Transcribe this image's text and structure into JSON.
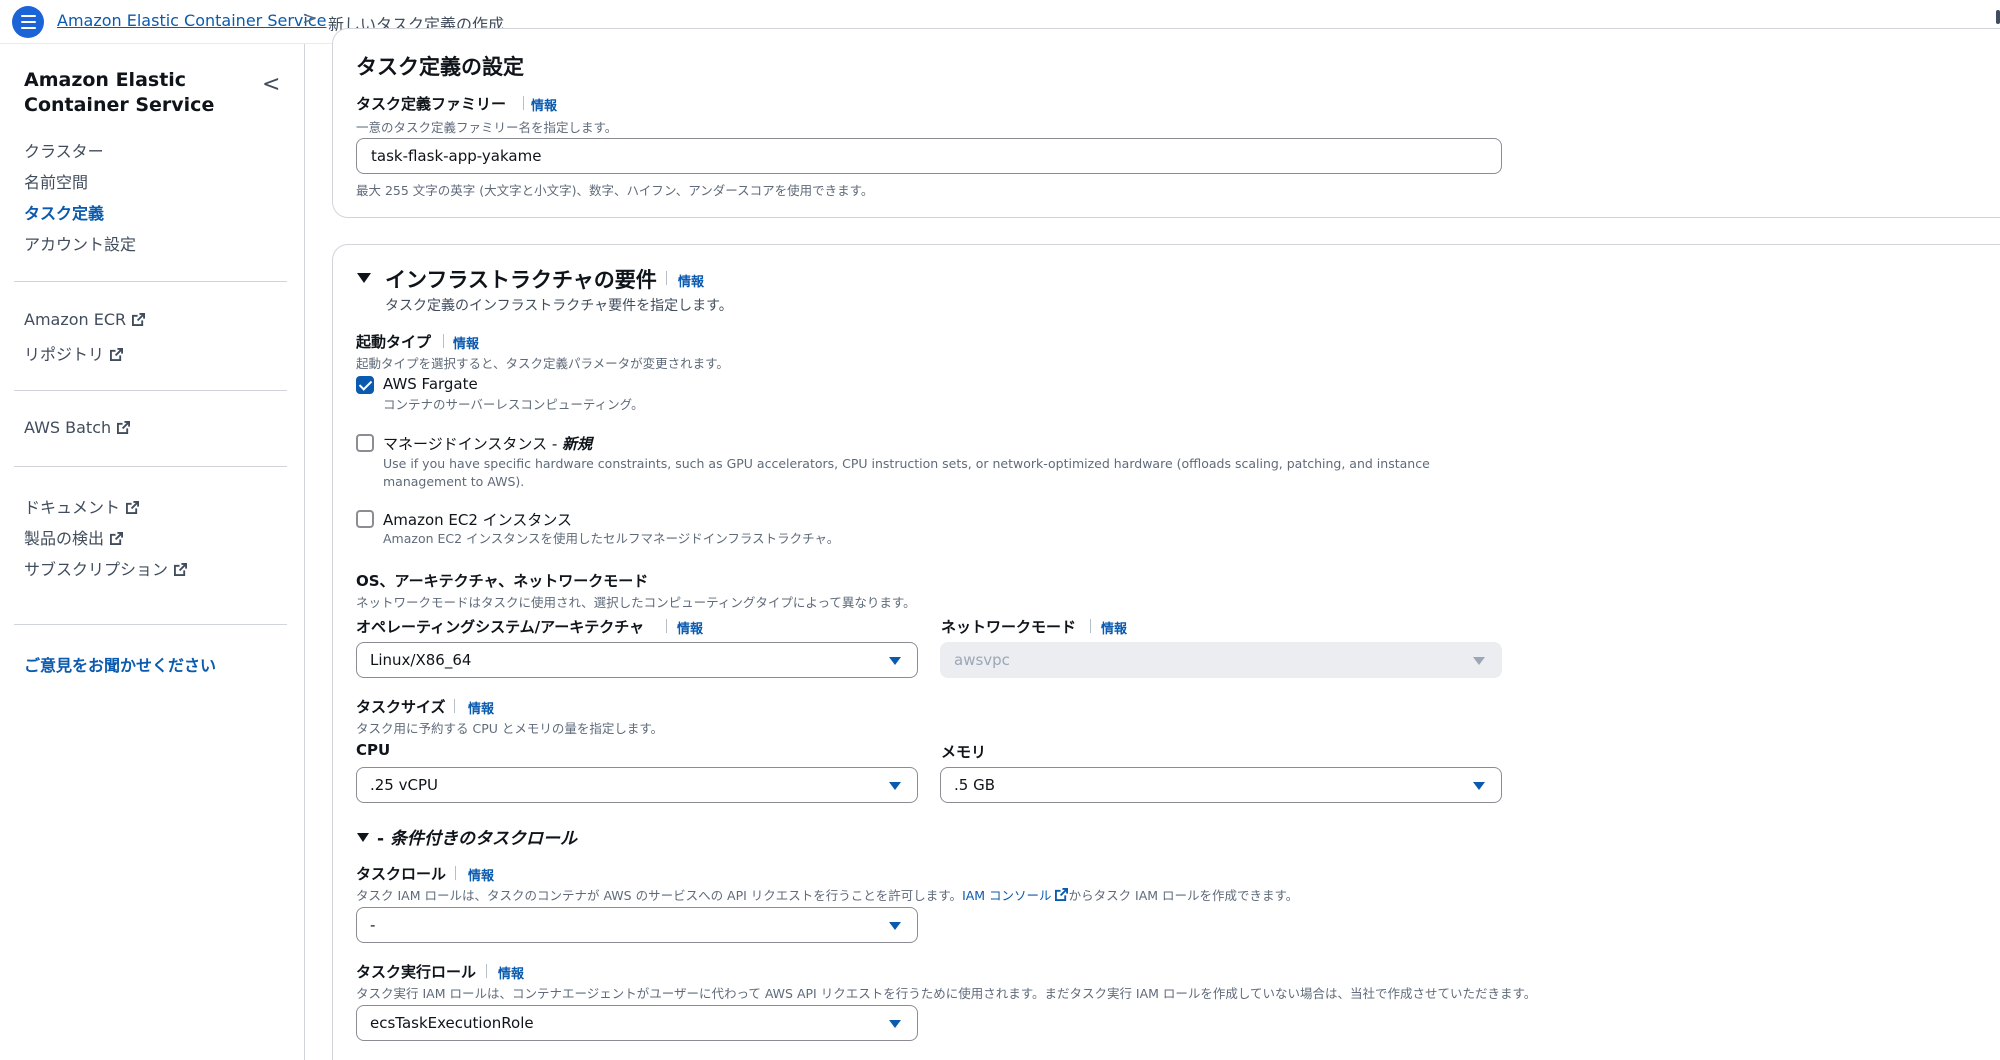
{
  "topbar": {
    "service_link": "Amazon Elastic Container Service",
    "separator": ">",
    "current_page": "新しいタスク定義の作成"
  },
  "sidebar": {
    "title": "Amazon Elastic Container Service",
    "collapse_glyph": "<",
    "nav": [
      {
        "label": "クラスター"
      },
      {
        "label": "名前空間"
      },
      {
        "label": "タスク定義",
        "active": true
      },
      {
        "label": "アカウント設定"
      }
    ],
    "group2": [
      {
        "label": "Amazon ECR",
        "external": true
      },
      {
        "label": "リポジトリ",
        "external": true
      }
    ],
    "group3": [
      {
        "label": "AWS Batch",
        "external": true
      }
    ],
    "group4": [
      {
        "label": "ドキュメント",
        "external": true
      },
      {
        "label": "製品の検出",
        "external": true
      },
      {
        "label": "サブスクリプション",
        "external": true
      }
    ],
    "feedback": "ご意見をお聞かせください"
  },
  "config": {
    "heading": "タスク定義の設定",
    "family_label": "タスク定義ファミリー",
    "info": "情報",
    "family_desc": "一意のタスク定義ファミリー名を指定します。",
    "family_value": "task-flask-app-yakame",
    "family_constraint": "最大 255 文字の英字 (大文字と小文字)、数字、ハイフン、アンダースコアを使用できます。"
  },
  "infra": {
    "heading": "インフラストラクチャの要件",
    "info": "情報",
    "desc": "タスク定義のインフラストラクチャ要件を指定します。",
    "launch_type_label": "起動タイプ",
    "launch_type_desc": "起動タイプを選択すると、タスク定義パラメータが変更されます。",
    "options": [
      {
        "label": "AWS Fargate",
        "desc": "コンテナのサーバーレスコンピューティング。",
        "checked": true
      },
      {
        "label": "マネージドインスタンス - ",
        "tag": "新規",
        "desc": "Use if you have specific hardware constraints, such as GPU accelerators, CPU instruction sets, or network-optimized hardware (offloads scaling, patching, and instance management to AWS).",
        "checked": false
      },
      {
        "label": "Amazon EC2 インスタンス",
        "desc": "Amazon EC2 インスタンスを使用したセルフマネージドインフラストラクチャ。",
        "checked": false
      }
    ],
    "os_section_label": "OS、アーキテクチャ、ネットワークモード",
    "os_section_desc": "ネットワークモードはタスクに使用され、選択したコンピューティングタイプによって異なります。",
    "os_arch_label": "オペレーティングシステム/アーキテクチャ",
    "os_arch_value": "Linux/X86_64",
    "network_mode_label": "ネットワークモード",
    "network_mode_value": "awsvpc",
    "task_size_label": "タスクサイズ",
    "task_size_desc": "タスク用に予約する CPU とメモリの量を指定します。",
    "cpu_label": "CPU",
    "cpu_value": ".25 vCPU",
    "memory_label": "メモリ",
    "memory_value": ".5 GB"
  },
  "task_role_section": {
    "heading_prefix": "- ",
    "heading": "条件付きのタスクロール",
    "task_role_label": "タスクロール",
    "task_role_desc_pre": "タスク IAM ロールは、タスクのコンテナが AWS のサービスへの API リクエストを行うことを許可します。",
    "task_role_desc_link": "IAM コンソール",
    "task_role_desc_post": "からタスク IAM ロールを作成できます。",
    "task_role_value": "-",
    "exec_role_label": "タスク実行ロール",
    "exec_role_desc": "タスク実行 IAM ロールは、コンテナエージェントがユーザーに代わって AWS API リクエストを行うために使用されます。まだタスク実行 IAM ロールを作成していない場合は、当社で作成させていただきます。",
    "exec_role_value": "ecsTaskExecutionRole"
  },
  "colors": {
    "accent": "#0a5aaf",
    "menu_button": "#1b64d8",
    "text": "#0f141a",
    "muted": "#5f6b7a"
  }
}
